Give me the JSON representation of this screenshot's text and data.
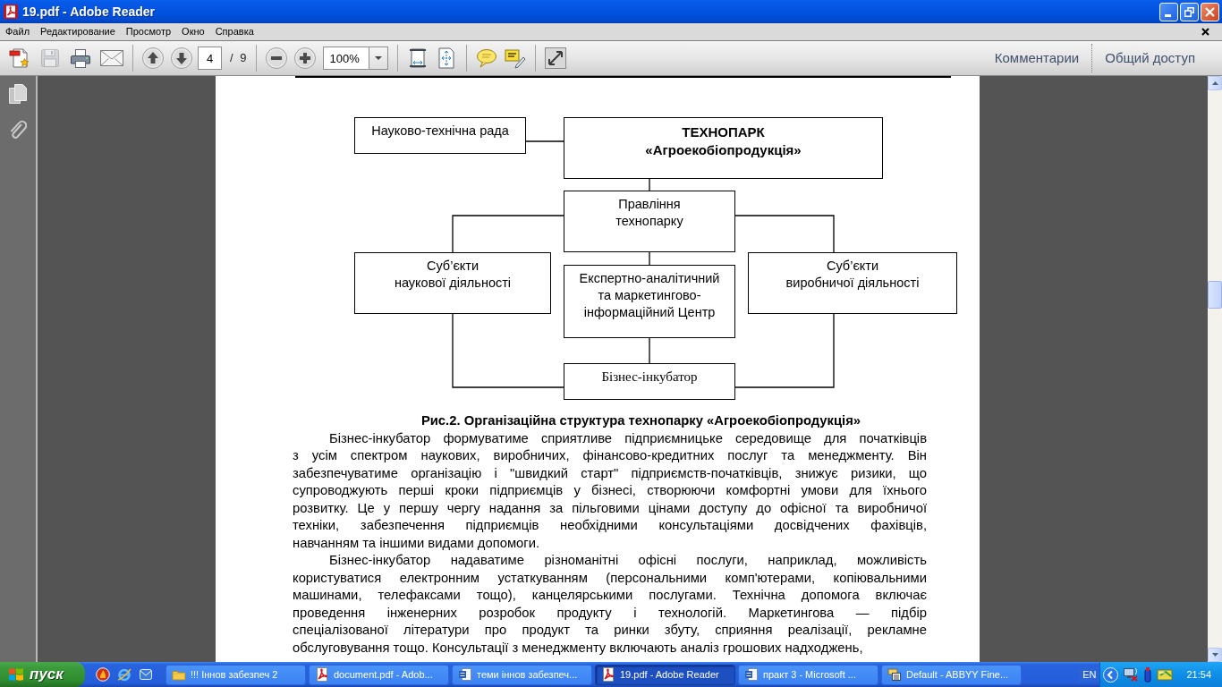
{
  "window": {
    "title": "19.pdf - Adobe Reader"
  },
  "menu": [
    "Файл",
    "Редактирование",
    "Просмотр",
    "Окно",
    "Справка"
  ],
  "toolbar": {
    "file_buttons": [
      {
        "disabled": false
      },
      {
        "disabled": true
      },
      {
        "disabled": false
      },
      {
        "disabled": false
      }
    ],
    "page_field": "4",
    "page_count": "/ 9",
    "zoom_field": "100%",
    "panel_links": [
      "Комментарии",
      "Общий доступ"
    ]
  },
  "document": {
    "diagram": {
      "nodes": [
        {
          "kind": "unit",
          "text": "Науково-технічна рада"
        },
        {
          "kind": "title",
          "text": "ТЕХНОПАРК\n«Агроекобіопродукція»"
        },
        {
          "kind": "unit",
          "text": "Правління\nтехнопарку"
        },
        {
          "kind": "unit",
          "text": "Суб’єкти\nнаукової діяльності"
        },
        {
          "kind": "unit",
          "text": "Експертно-аналітичний\nта маркетингово-\nінформаційний Центр"
        },
        {
          "kind": "unit",
          "text": "Суб’єкти\nвиробничої діяльності"
        },
        {
          "kind": "serif",
          "text": "Бізнес-інкубатор"
        }
      ]
    },
    "caption": "Рис.2. Організаційна структура технопарку «Агроекобіопродукція»",
    "paragraphs": [
      [
        "Бізнес-інкубатор формуватиме сприятливе підприємницьке середовище для початківців",
        "з усім спектром наукових, виробничих, фінансово-кредитних послуг та менеджменту. Він",
        "забезпечуватиме організацію і \"швидкий старт\" підприємств-початківців, знижує ризики, що",
        "супроводжують перші кроки підприємців у бізнесі, створюючи комфортні умови для їхнього",
        "розвитку. Це у першу чергу надання за пільговими цінами доступу до офісної та виробничої",
        "техніки, забезпечення підприємців необхідними консультаціями досвідчених фахівців,",
        "навчанням та іншими видами допомоги."
      ],
      [
        "Бізнес-інкубатор надаватиме різноманітні офісні послуги, наприклад, можливість",
        "користуватися електронним устаткуванням (персональними комп'ютерами, копіювальними",
        "машинами, телефаксами тощо), канцелярськими послугами. Технічна допомога включає",
        "проведення інженерних розробок продукту і технологій. Маркетингова — підбір",
        "спеціалізованої літератури про продукт та ринки збуту, сприяння реалізації, рекламне",
        "обслуговування тощо. Консультації з менеджменту включають аналіз грошових надходжень,"
      ]
    ]
  },
  "taskbar": {
    "start": "пуск",
    "tasks": [
      {
        "kind": "folder",
        "label": "!!! Іннов забезпеч 2",
        "selected": false
      },
      {
        "kind": "pdf",
        "label": "document.pdf - Adob...",
        "selected": false
      },
      {
        "kind": "word",
        "label": "теми іннов забезпеч...",
        "selected": false
      },
      {
        "kind": "pdf",
        "label": "19.pdf - Adobe Reader",
        "selected": true
      },
      {
        "kind": "word",
        "label": "практ 3 - Microsoft ...",
        "selected": false
      },
      {
        "kind": "scanner",
        "label": "Default - ABBYY Fine...",
        "selected": false
      }
    ],
    "language": "EN",
    "clock": "21:54"
  }
}
